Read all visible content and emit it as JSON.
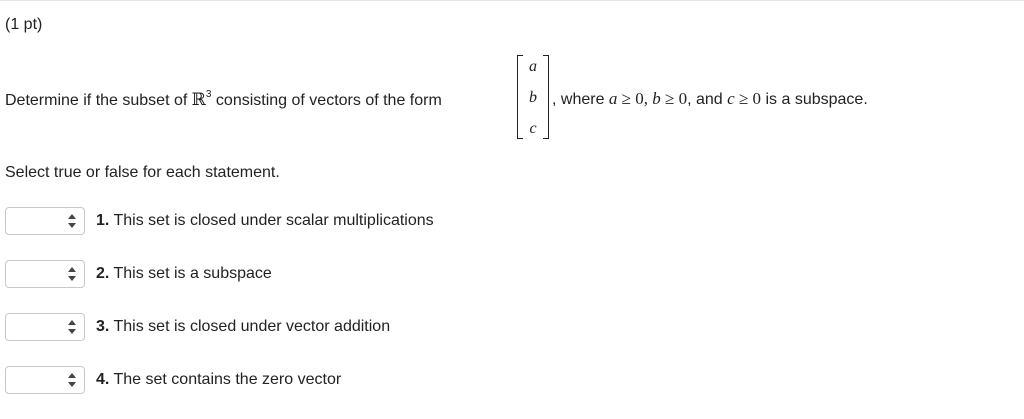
{
  "header": {
    "points": "(1 pt)"
  },
  "question": {
    "prefix": "Determine if the subset of ",
    "space_symbol": "ℝ",
    "space_exponent": "3",
    "middle": " consisting of vectors of the form",
    "vector": [
      "a",
      "b",
      "c"
    ],
    "suffix_where": ", where ",
    "cond_a_var": "a",
    "cond_a_rel": " ≥ 0, ",
    "cond_b_var": "b",
    "cond_b_rel": " ≥ 0",
    "cond_join": ", and ",
    "cond_c_var": "c",
    "cond_c_rel": " ≥ 0",
    "suffix_end": " is a subspace."
  },
  "instructions": "Select true or false for each statement.",
  "statements": [
    {
      "number": "1.",
      "text": " This set is closed under scalar multiplications",
      "selected": ""
    },
    {
      "number": "2.",
      "text": " This set is a subspace",
      "selected": ""
    },
    {
      "number": "3.",
      "text": " This set is closed under vector addition",
      "selected": ""
    },
    {
      "number": "4.",
      "text": " The set contains the zero vector",
      "selected": ""
    }
  ]
}
